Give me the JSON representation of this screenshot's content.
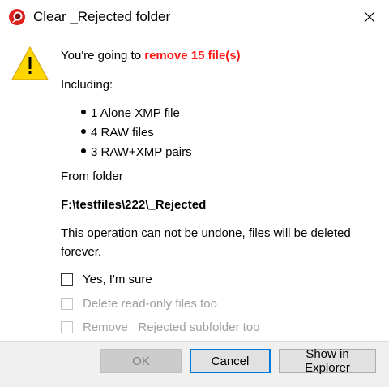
{
  "window": {
    "title": "Clear _Rejected folder",
    "close_icon": "close-icon",
    "app_icon": "app-logo-icon",
    "warning_icon": "warning-icon"
  },
  "message": {
    "lead": "You're going to ",
    "highlight": "remove 15 file(s)",
    "including": "Including:",
    "items": [
      "1 Alone XMP file",
      "4 RAW files",
      "3 RAW+XMP pairs"
    ],
    "from_folder": "From folder",
    "path": "F:\\testfiles\\222\\_Rejected",
    "warning": "This operation can not be undone, files will be deleted forever."
  },
  "options": [
    {
      "label": "Yes, I'm sure",
      "checked": false,
      "enabled": true
    },
    {
      "label": "Delete read-only files too",
      "checked": false,
      "enabled": false
    },
    {
      "label": "Remove _Rejected subfolder too",
      "checked": false,
      "enabled": false
    }
  ],
  "buttons": {
    "ok": "OK",
    "cancel": "Cancel",
    "explorer": "Show in Explorer"
  },
  "colors": {
    "highlight": "#ff1a1a",
    "warning_fill": "#ffd700",
    "focus_border": "#0078d7"
  }
}
